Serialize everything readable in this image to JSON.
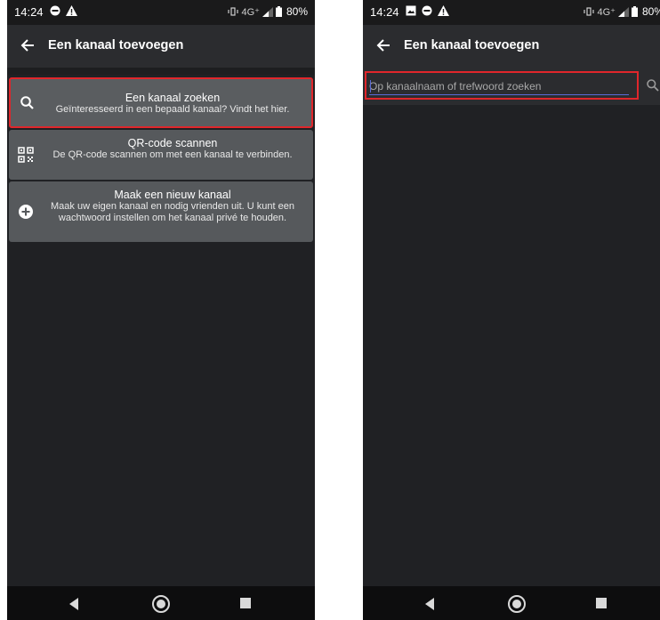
{
  "left": {
    "status": {
      "time": "14:24",
      "network": "4G⁺",
      "battery": "80%"
    },
    "appbar": {
      "title": "Een kanaal toevoegen"
    },
    "cards": [
      {
        "title": "Een kanaal zoeken",
        "desc": "Geïnteresseerd in een bepaald kanaal? Vindt het hier.",
        "icon": "search-icon"
      },
      {
        "title": "QR-code scannen",
        "desc": "De QR-code scannen om met een kanaal te verbinden.",
        "icon": "qr-code-icon"
      },
      {
        "title": "Maak een nieuw kanaal",
        "desc": "Maak uw eigen kanaal en nodig vrienden uit. U kunt een wachtwoord instellen om het kanaal privé te houden.",
        "icon": "add-circle-icon"
      }
    ]
  },
  "right": {
    "status": {
      "time": "14:24",
      "network": "4G⁺",
      "battery": "80%"
    },
    "appbar": {
      "title": "Een kanaal toevoegen"
    },
    "search": {
      "placeholder": "Op kanaalnaam of trefwoord zoeken",
      "value": ""
    }
  },
  "colors": {
    "highlight": "#e0262b",
    "card": "#56595c",
    "background": "#202124",
    "underline": "#5a6bd6"
  }
}
